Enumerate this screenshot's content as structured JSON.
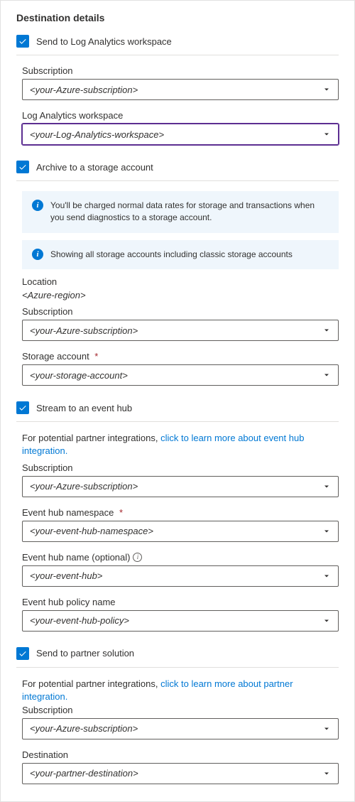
{
  "heading": "Destination details",
  "logAnalytics": {
    "checkboxLabel": "Send to Log Analytics workspace",
    "subscription": {
      "label": "Subscription",
      "value": "<your-Azure-subscription>"
    },
    "workspace": {
      "label": "Log Analytics workspace",
      "value": "<your-Log-Analytics-workspace>"
    }
  },
  "storage": {
    "checkboxLabel": "Archive to a storage account",
    "info1": "You'll be charged normal data rates for storage and transactions when you send diagnostics to a storage account.",
    "info2": "Showing all storage accounts including classic storage accounts",
    "location": {
      "label": "Location",
      "value": "<Azure-region>"
    },
    "subscription": {
      "label": "Subscription",
      "value": "<your-Azure-subscription>"
    },
    "account": {
      "label": "Storage account",
      "value": "<your-storage-account>"
    }
  },
  "eventHub": {
    "checkboxLabel": "Stream to an event hub",
    "introText": "For potential partner integrations, ",
    "introLink": "click to learn more about event hub integration.",
    "subscription": {
      "label": "Subscription",
      "value": "<your-Azure-subscription>"
    },
    "namespace": {
      "label": "Event hub namespace",
      "value": "<your-event-hub-namespace>"
    },
    "name": {
      "label": "Event hub name (optional)",
      "value": "<your-event-hub>"
    },
    "policy": {
      "label": "Event hub policy name",
      "value": "<your-event-hub-policy>"
    }
  },
  "partner": {
    "checkboxLabel": "Send to partner solution",
    "introText": "For potential partner integrations, ",
    "introLink": "click to learn more about partner integration.",
    "subscription": {
      "label": "Subscription",
      "value": "<your-Azure-subscription>"
    },
    "destination": {
      "label": "Destination",
      "value": "<your-partner-destination>"
    }
  }
}
